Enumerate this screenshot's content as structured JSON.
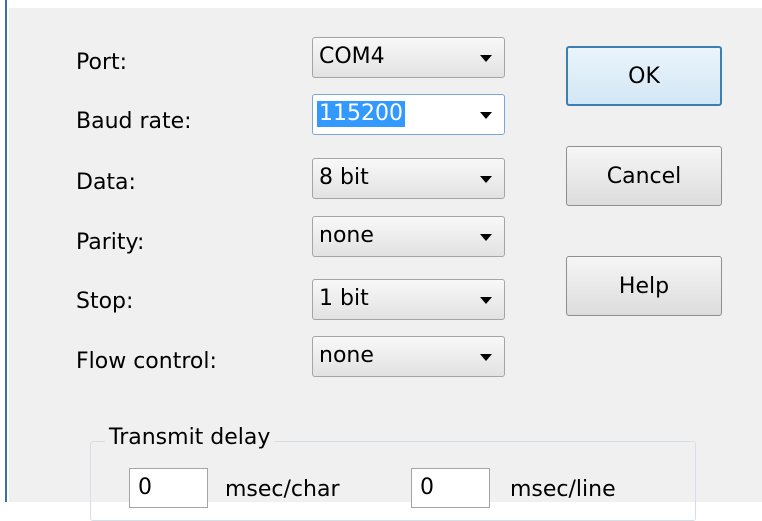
{
  "labels": {
    "port": "Port:",
    "baud_rate": "Baud rate:",
    "data": "Data:",
    "parity": "Parity:",
    "stop": "Stop:",
    "flow_control": "Flow control:"
  },
  "fields": {
    "port": "COM4",
    "baud_rate": "115200",
    "data": "8 bit",
    "parity": "none",
    "stop": "1 bit",
    "flow_control": "none"
  },
  "buttons": {
    "ok": "OK",
    "cancel": "Cancel",
    "help": "Help"
  },
  "transmit_delay": {
    "title": "Transmit delay",
    "char_value": "0",
    "char_unit": "msec/char",
    "line_value": "0",
    "line_unit": "msec/line"
  },
  "colors": {
    "selection": "#3399ff",
    "focus_border": "#3c7fb1",
    "window_border": "#3a6fb0",
    "dialog_background": "#f0f0f0"
  }
}
